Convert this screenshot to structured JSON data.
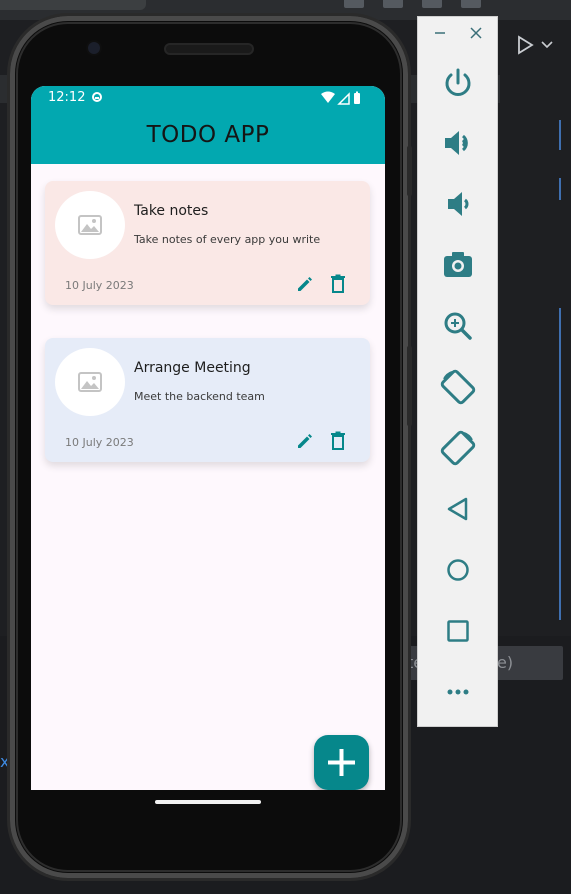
{
  "ide": {
    "input_text": "te",
    "input_tail": "e)",
    "blue_glyph": "x"
  },
  "statusbar": {
    "time": "12:12"
  },
  "app": {
    "title": "TODO APP"
  },
  "todos": [
    {
      "title": "Take notes",
      "description": "Take notes of every app you write",
      "date": "10 July 2023",
      "bg_color": "#fae8e6"
    },
    {
      "title": "Arrange Meeting",
      "description": "Meet the backend team",
      "date": "10 July 2023",
      "bg_color": "#e6ecf8"
    }
  ],
  "colors": {
    "appbar": "#02a8b0",
    "accent": "#06878b",
    "screen_bg": "#fef8fd",
    "emulator_icon": "#2e7d85"
  },
  "emulator_controls": [
    "power-icon",
    "volume-up-icon",
    "volume-down-icon",
    "camera-icon",
    "zoom-icon",
    "rotate-left-icon",
    "rotate-right-icon",
    "back-icon",
    "home-icon",
    "overview-icon",
    "more-icon"
  ]
}
